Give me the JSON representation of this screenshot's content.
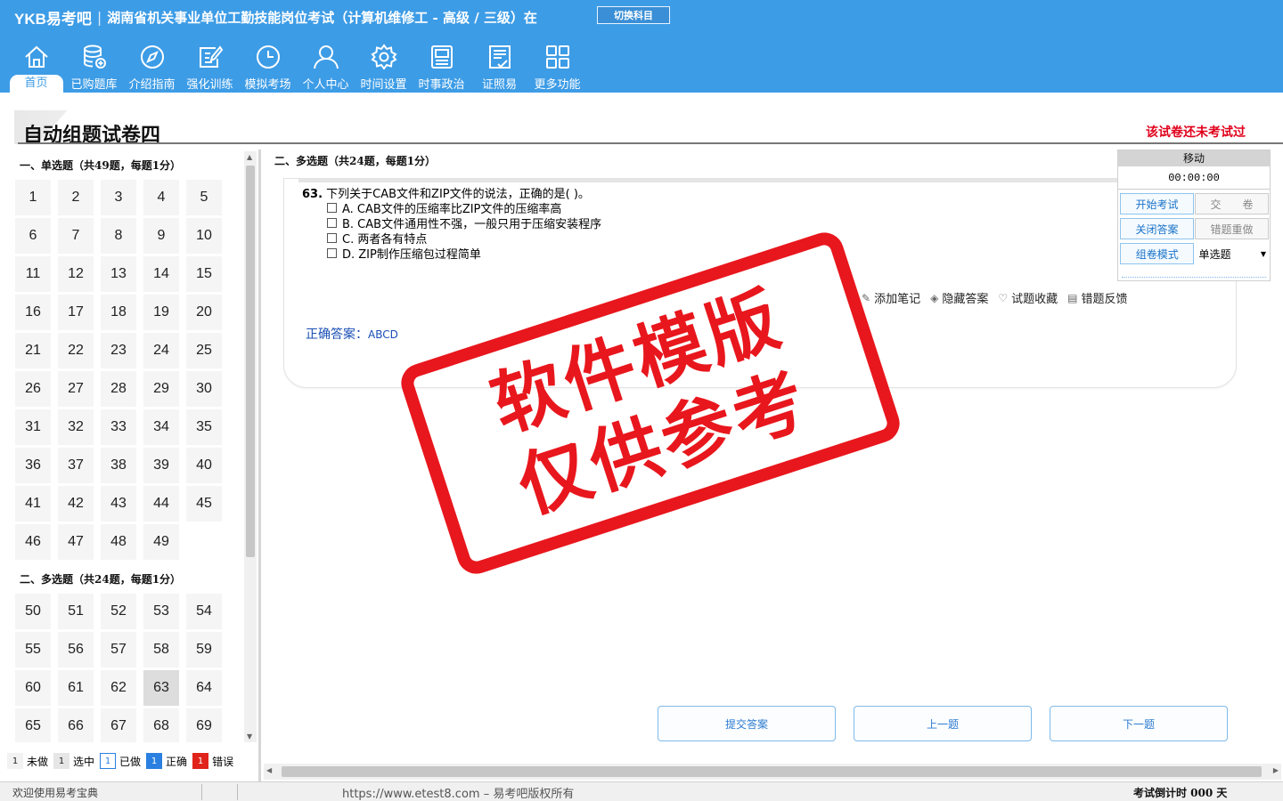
{
  "header": {
    "brand": "YKB易考吧",
    "exam_title": "湖南省机关事业单位工勤技能岗位考试（计算机维修工 - 高级 / 三级）在",
    "switch_label": "切换科目"
  },
  "nav": [
    {
      "label": "首页",
      "icon": "home-icon"
    },
    {
      "label": "已购题库",
      "icon": "database-icon"
    },
    {
      "label": "介绍指南",
      "icon": "compass-icon"
    },
    {
      "label": "强化训练",
      "icon": "edit-icon"
    },
    {
      "label": "模拟考场",
      "icon": "clock-icon"
    },
    {
      "label": "个人中心",
      "icon": "user-icon"
    },
    {
      "label": "时间设置",
      "icon": "gear-icon"
    },
    {
      "label": "时事政治",
      "icon": "news-icon"
    },
    {
      "label": "证照易",
      "icon": "certificate-icon"
    },
    {
      "label": "更多功能",
      "icon": "grid-icon"
    }
  ],
  "paper": {
    "title": "自动组题试卷四",
    "status": "该试卷还未考试过"
  },
  "left_panel": {
    "single_title": "一、单选题（共49题，每题1分）",
    "single_numbers": [
      "1",
      "2",
      "3",
      "4",
      "5",
      "6",
      "7",
      "8",
      "9",
      "10",
      "11",
      "12",
      "13",
      "14",
      "15",
      "16",
      "17",
      "18",
      "19",
      "20",
      "21",
      "22",
      "23",
      "24",
      "25",
      "26",
      "27",
      "28",
      "29",
      "30",
      "31",
      "32",
      "33",
      "34",
      "35",
      "36",
      "37",
      "38",
      "39",
      "40",
      "41",
      "42",
      "43",
      "44",
      "45",
      "46",
      "47",
      "48",
      "49"
    ],
    "multi_title": "二、多选题（共24题，每题1分）",
    "multi_numbers": [
      "50",
      "51",
      "52",
      "53",
      "54",
      "55",
      "56",
      "57",
      "58",
      "59",
      "60",
      "61",
      "62",
      "63",
      "64",
      "65",
      "66",
      "67",
      "68",
      "69"
    ],
    "current": "63"
  },
  "legend": {
    "marker": "1",
    "undone": "未做",
    "selected": "选中",
    "done": "已做",
    "correct": "正确",
    "wrong": "错误"
  },
  "question": {
    "section_title": "二、多选题（共24题，每题1分）",
    "number": "63.",
    "stem": "下列关于CAB文件和ZIP文件的说法，正确的是(  )。",
    "options": [
      "A. CAB文件的压缩率比ZIP文件的压缩率高",
      "B. CAB文件通用性不强，一般只用于压缩安装程序",
      "C. 两者各有特点",
      "D. ZIP制作压缩包过程简单"
    ],
    "tools": [
      "添加笔记",
      "隐藏答案",
      "试题收藏",
      "错题反馈"
    ],
    "answer_label": "正确答案：",
    "answer_value": "ABCD"
  },
  "timer_panel": {
    "head": "移动",
    "time": "00:00:00",
    "start": "开始考试",
    "submit_paper": "交　　卷",
    "close_answer": "关闭答案",
    "redo_wrong": "错题重做",
    "mode": "组卷模式",
    "mode_value": "单选题"
  },
  "bottom_buttons": {
    "submit": "提交答案",
    "prev": "上一题",
    "next": "下一题"
  },
  "statusbar": {
    "welcome": "欢迎使用易考宝典",
    "copyright": "https://www.etest8.com – 易考吧版权所有",
    "countdown": "考试倒计时 000 天"
  },
  "watermark": {
    "line1": "软件模版",
    "line2": "仅供参考"
  }
}
